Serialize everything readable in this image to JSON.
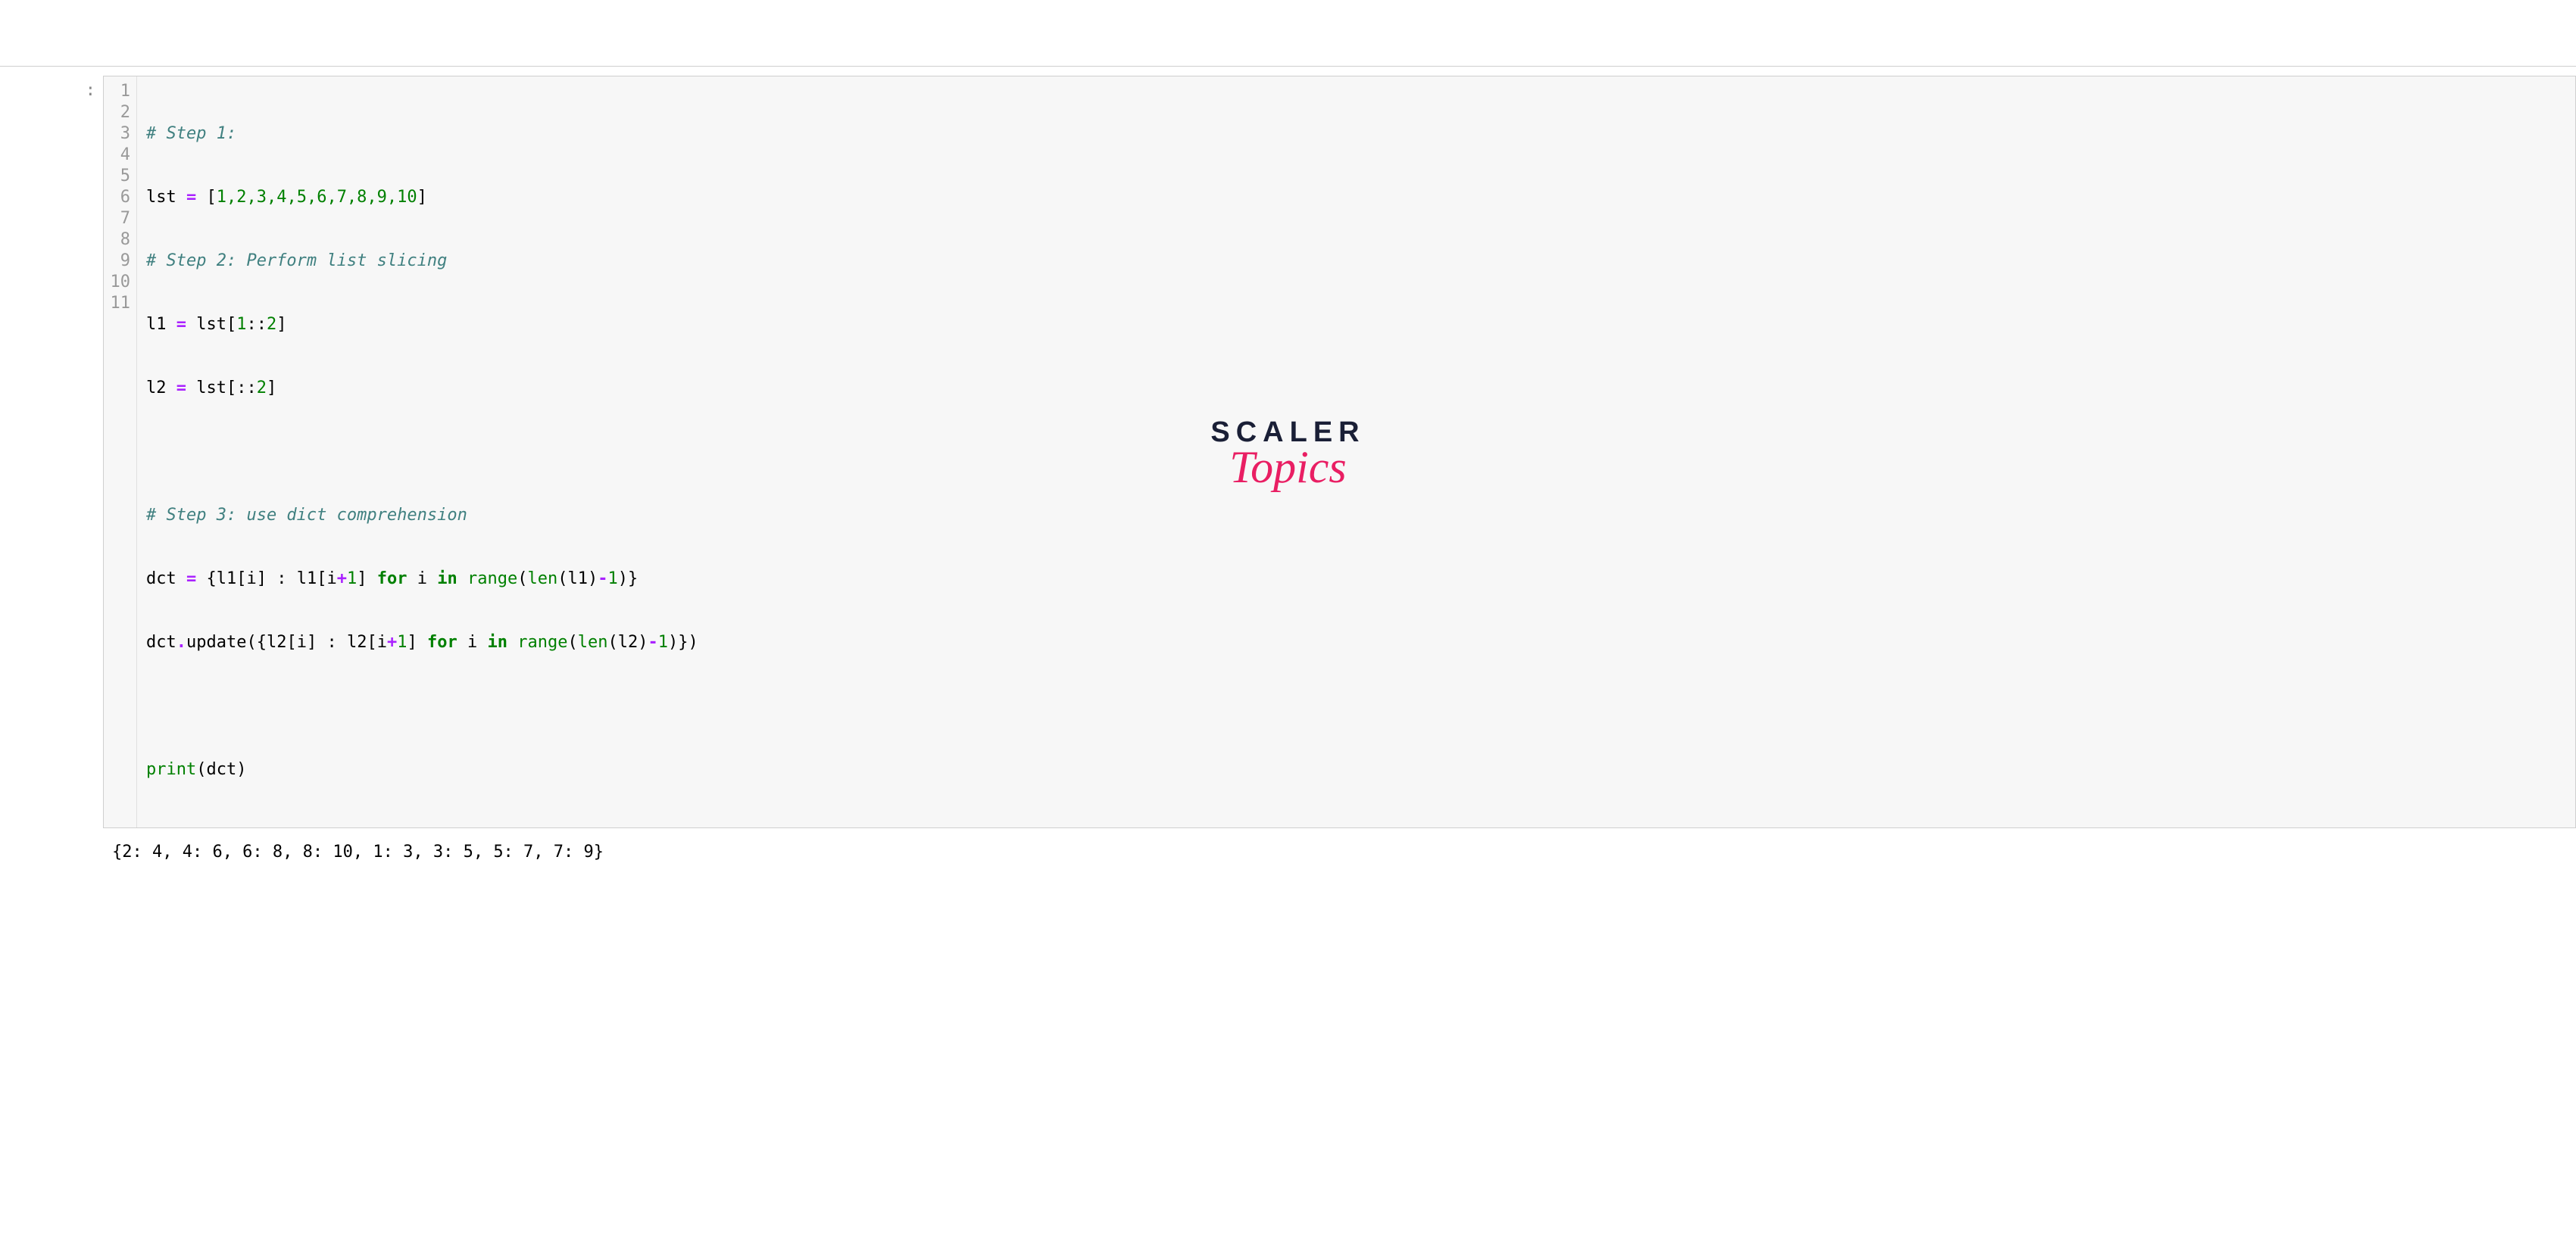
{
  "prompt": ":",
  "gutter": [
    "1",
    "2",
    "3",
    "4",
    "5",
    "6",
    "7",
    "8",
    "9",
    "10",
    "11"
  ],
  "code": {
    "l1": {
      "comment": "# Step 1:"
    },
    "l2": {
      "var": "lst",
      "eq": " = ",
      "brO": "[",
      "nums": "1,2,3,4,5,6,7,8,9,10",
      "brC": "]"
    },
    "l3": {
      "comment": "# Step 2: Perform list slicing"
    },
    "l4": {
      "var": "l1",
      "eq": " = ",
      "src": "lst",
      "slO": "[",
      "a": "1",
      "col1": ":",
      "col2": ":",
      "b": "2",
      "slC": "]"
    },
    "l5": {
      "var": "l2",
      "eq": " = ",
      "src": "lst",
      "slO": "[",
      "col1": ":",
      "col2": ":",
      "b": "2",
      "slC": "]"
    },
    "l7": {
      "comment": "# Step 3: use dict comprehension"
    },
    "l8": {
      "var": "dct",
      "eq": " = ",
      "brO": "{",
      "k1": "l1",
      "brO2": "[",
      "i1": "i",
      "brC2": "]",
      "colon": " : ",
      "k2": "l1",
      "brO3": "[",
      "i2": "i",
      "plus": "+",
      "one": "1",
      "brC3": "]",
      "sp": " ",
      "for": "for",
      "sp2": " ",
      "i3": "i",
      "sp3": " ",
      "in": "in",
      "sp4": " ",
      "range": "range",
      "pO": "(",
      "len": "len",
      "pO2": "(",
      "arg": "l1",
      "pC2": ")",
      "minus": "-",
      "one2": "1",
      "pC": ")",
      "brC": "}"
    },
    "l9": {
      "var": "dct",
      "dot": ".",
      "upd": "update",
      "pO": "(",
      "brO": "{",
      "k1": "l2",
      "brO2": "[",
      "i1": "i",
      "brC2": "]",
      "colon": " : ",
      "k2": "l2",
      "brO3": "[",
      "i2": "i",
      "plus": "+",
      "one": "1",
      "brC3": "]",
      "sp": " ",
      "for": "for",
      "sp2": " ",
      "i3": "i",
      "sp3": " ",
      "in": "in",
      "sp4": " ",
      "range": "range",
      "pO2": "(",
      "len": "len",
      "pO3": "(",
      "arg": "l2",
      "pC3": ")",
      "minus": "-",
      "one2": "1",
      "pC2": ")",
      "brC": "}",
      "pC": ")"
    },
    "l11": {
      "print": "print",
      "pO": "(",
      "arg": "dct",
      "pC": ")"
    }
  },
  "output": "{2: 4, 4: 6, 6: 8, 8: 10, 1: 3, 3: 5, 5: 7, 7: 9}",
  "logo": {
    "line1": "SCALER",
    "line2": "Topics"
  }
}
